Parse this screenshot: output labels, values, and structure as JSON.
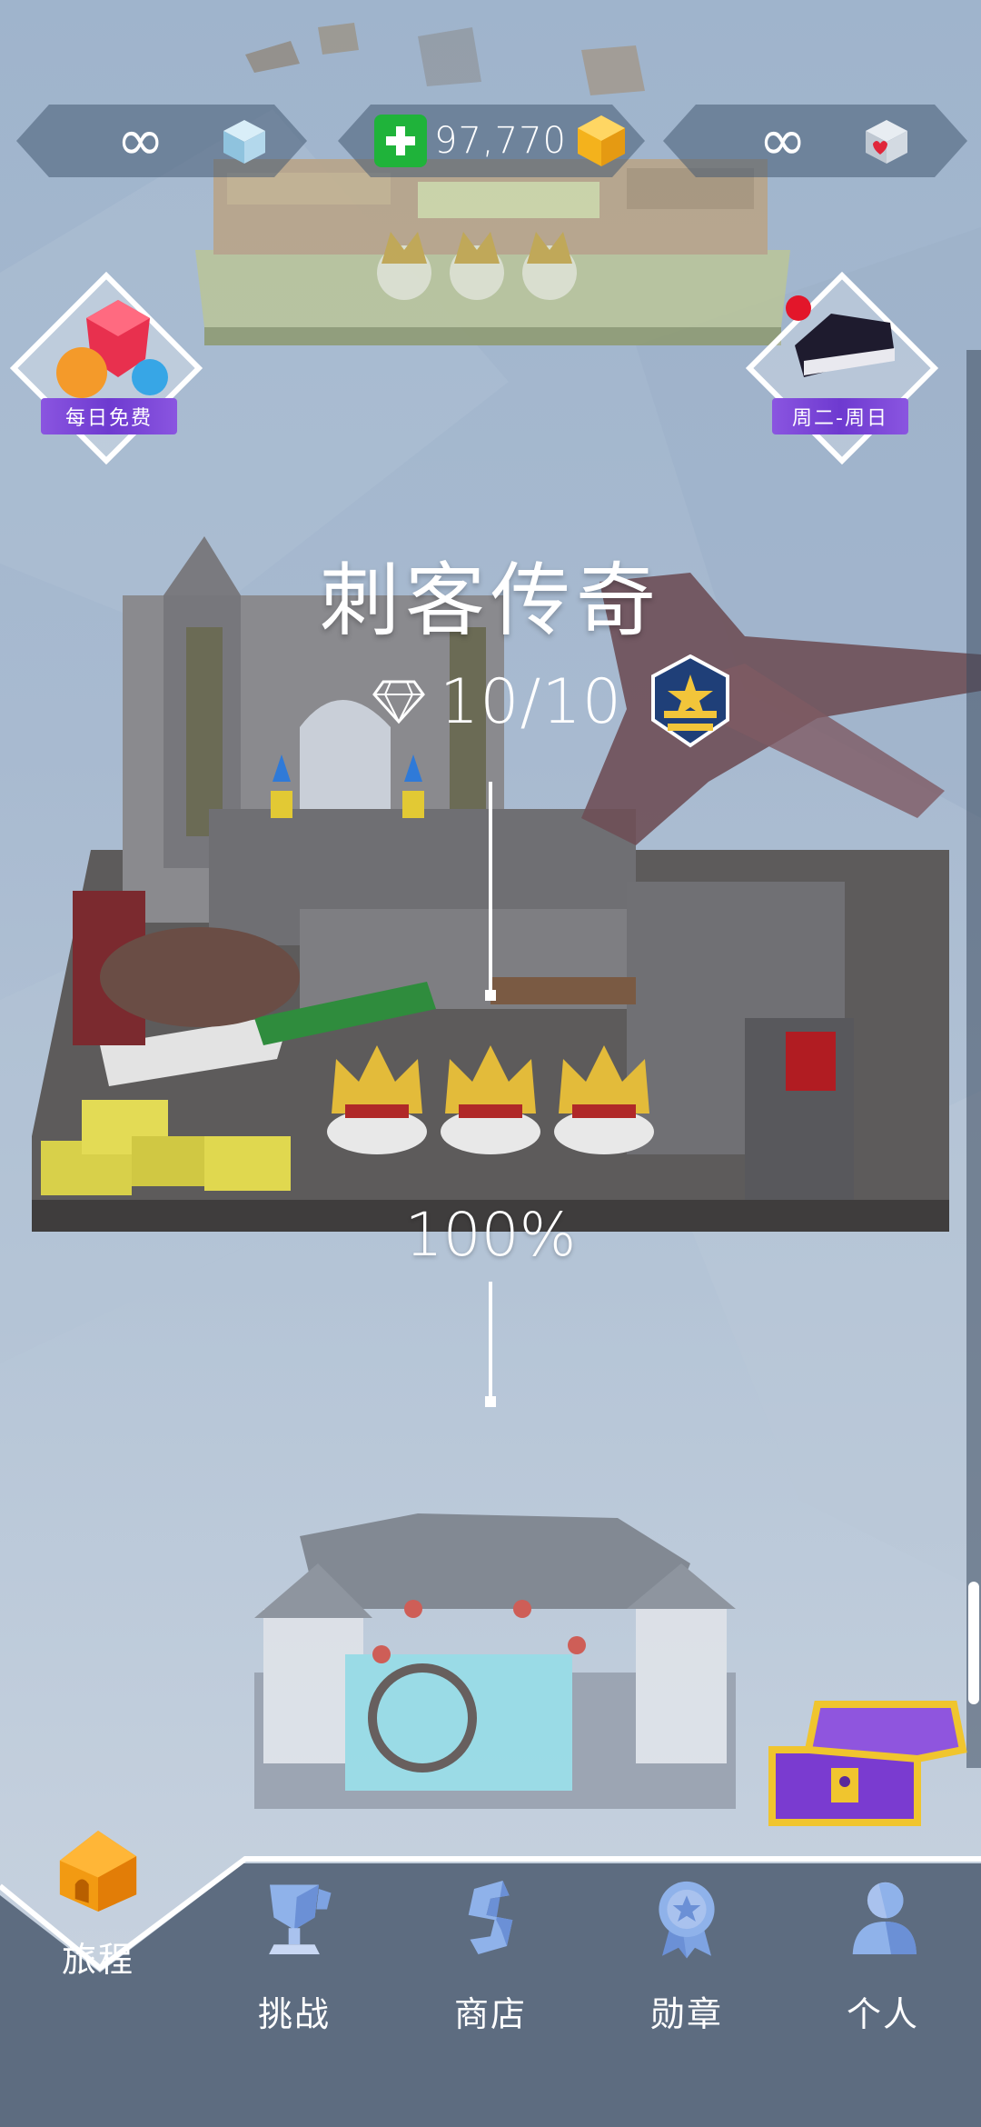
{
  "resources": {
    "gems_left": "∞",
    "coins": "97,770",
    "hearts_right": "∞"
  },
  "events": {
    "daily_free": "每日免费",
    "weekly": "周二-周日"
  },
  "level": {
    "title": "刺客传奇",
    "gems": "10/10",
    "progress": "100%",
    "progress_value": 1.0
  },
  "nav": {
    "items": [
      {
        "label": "旅程",
        "icon": "house-icon",
        "active": true
      },
      {
        "label": "挑战",
        "icon": "trophy-icon",
        "active": false
      },
      {
        "label": "商店",
        "icon": "shop-s-icon",
        "active": false
      },
      {
        "label": "勋章",
        "icon": "medal-icon",
        "active": false
      },
      {
        "label": "个人",
        "icon": "person-icon",
        "active": false
      }
    ]
  },
  "colors": {
    "accent_purple": "#7a45d8",
    "coin_gold": "#f4b21c",
    "plus_green": "#1fb33a",
    "nav_bg": "#5d6c80"
  }
}
